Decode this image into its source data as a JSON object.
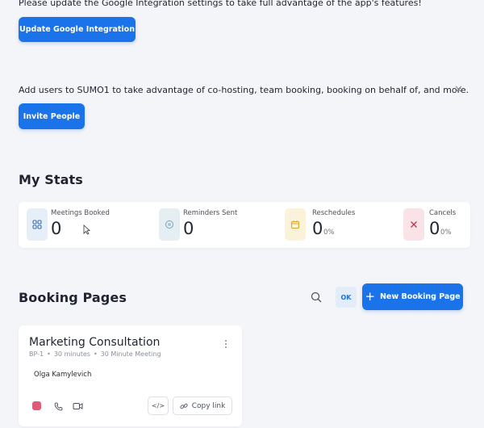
{
  "google_notice": {
    "text": "Please update the Google Integration settings to take full advantage of the app's features!",
    "button_label": "Update Google Integration"
  },
  "users_notice": {
    "text": "Add users to SUMO1 to take advantage of co-hosting, team booking, booking on behalf of, and more.",
    "button_label": "Invite People",
    "close_glyph": "✕"
  },
  "stats": {
    "title": "My Stats",
    "items": [
      {
        "label": "Meetings Booked",
        "value": "0",
        "pct": "",
        "icon": "grid-icon",
        "tint": "#e6eef7",
        "accent": "#3b6fb0"
      },
      {
        "label": "Reminders Sent",
        "value": "0",
        "pct": "",
        "icon": "bell-icon",
        "tint": "#e4eef3",
        "accent": "#7aa3b8"
      },
      {
        "label": "Reschedules",
        "value": "0",
        "pct": "0%",
        "icon": "calendar-icon",
        "tint": "#fbf3d9",
        "accent": "#d9a72a"
      },
      {
        "label": "Cancels",
        "value": "0",
        "pct": "0%",
        "icon": "x-icon",
        "tint": "#f9e3e6",
        "accent": "#c0394f"
      }
    ]
  },
  "booking_pages": {
    "title": "Booking Pages",
    "ok_label": "OK",
    "new_button_label": "New Booking Page",
    "new_button_glyph": "+",
    "cards": [
      {
        "title": "Marketing Consultation",
        "code": "BP-1",
        "duration": "30 minutes",
        "meeting_type": "30 Minute Meeting",
        "host": "Olga Kamylevich",
        "copy_label": "Copy link",
        "embed_glyph": "</>",
        "color": "#e05a78"
      }
    ]
  },
  "colors": {
    "primary": "#1a73e8",
    "background": "#f4f5f8"
  }
}
